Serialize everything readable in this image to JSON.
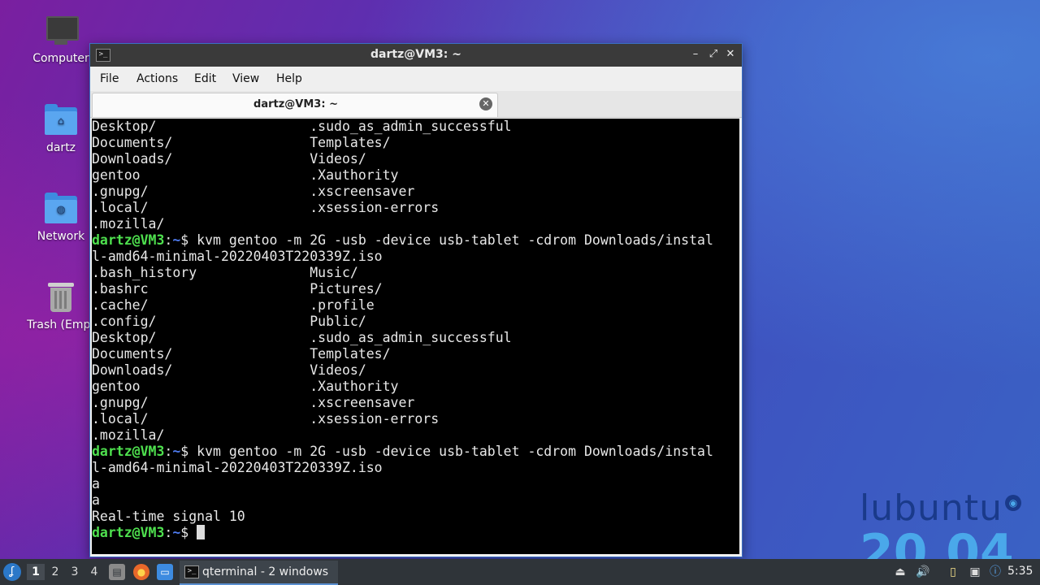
{
  "desktop": {
    "icons": [
      {
        "label": "Computer"
      },
      {
        "label": "dartz"
      },
      {
        "label": "Network"
      },
      {
        "label": "Trash (Empt"
      }
    ],
    "branding": {
      "name": "lubuntu",
      "version": "20.04"
    }
  },
  "window": {
    "title": "dartz@VM3: ~",
    "controls": {
      "minimize": "–",
      "maximize": "⤢",
      "close": "✕"
    },
    "menu": [
      "File",
      "Actions",
      "Edit",
      "View",
      "Help"
    ],
    "tab": {
      "label": "dartz@VM3: ~",
      "close": "✕"
    }
  },
  "terminal": {
    "prompt_user": "dartz@VM3",
    "prompt_sep": ":",
    "prompt_path": "~",
    "prompt_symbol": "$ ",
    "lines": [
      {
        "type": "text",
        "text": "Desktop/                   .sudo_as_admin_successful"
      },
      {
        "type": "text",
        "text": "Documents/                 Templates/"
      },
      {
        "type": "text",
        "text": "Downloads/                 Videos/"
      },
      {
        "type": "text",
        "text": "gentoo                     .Xauthority"
      },
      {
        "type": "text",
        "text": ".gnupg/                    .xscreensaver"
      },
      {
        "type": "text",
        "text": ".local/                    .xsession-errors"
      },
      {
        "type": "text",
        "text": ".mozilla/"
      },
      {
        "type": "prompt",
        "text": "kvm gentoo -m 2G -usb -device usb-tablet -cdrom Downloads/instal"
      },
      {
        "type": "text",
        "text": "l-amd64-minimal-20220403T220339Z.iso"
      },
      {
        "type": "text",
        "text": ".bash_history              Music/"
      },
      {
        "type": "text",
        "text": ".bashrc                    Pictures/"
      },
      {
        "type": "text",
        "text": ".cache/                    .profile"
      },
      {
        "type": "text",
        "text": ".config/                   Public/"
      },
      {
        "type": "text",
        "text": "Desktop/                   .sudo_as_admin_successful"
      },
      {
        "type": "text",
        "text": "Documents/                 Templates/"
      },
      {
        "type": "text",
        "text": "Downloads/                 Videos/"
      },
      {
        "type": "text",
        "text": "gentoo                     .Xauthority"
      },
      {
        "type": "text",
        "text": ".gnupg/                    .xscreensaver"
      },
      {
        "type": "text",
        "text": ".local/                    .xsession-errors"
      },
      {
        "type": "text",
        "text": ".mozilla/"
      },
      {
        "type": "prompt",
        "text": "kvm gentoo -m 2G -usb -device usb-tablet -cdrom Downloads/instal"
      },
      {
        "type": "text",
        "text": "l-amd64-minimal-20220403T220339Z.iso"
      },
      {
        "type": "text",
        "text": "a"
      },
      {
        "type": "text",
        "text": "a"
      },
      {
        "type": "text",
        "text": "Real-time signal 10"
      },
      {
        "type": "prompt",
        "text": ""
      }
    ]
  },
  "taskbar": {
    "workspaces": [
      "1",
      "2",
      "3",
      "4"
    ],
    "active_workspace": "1",
    "task_label": "qterminal - 2 windows",
    "clock": "5:35"
  }
}
